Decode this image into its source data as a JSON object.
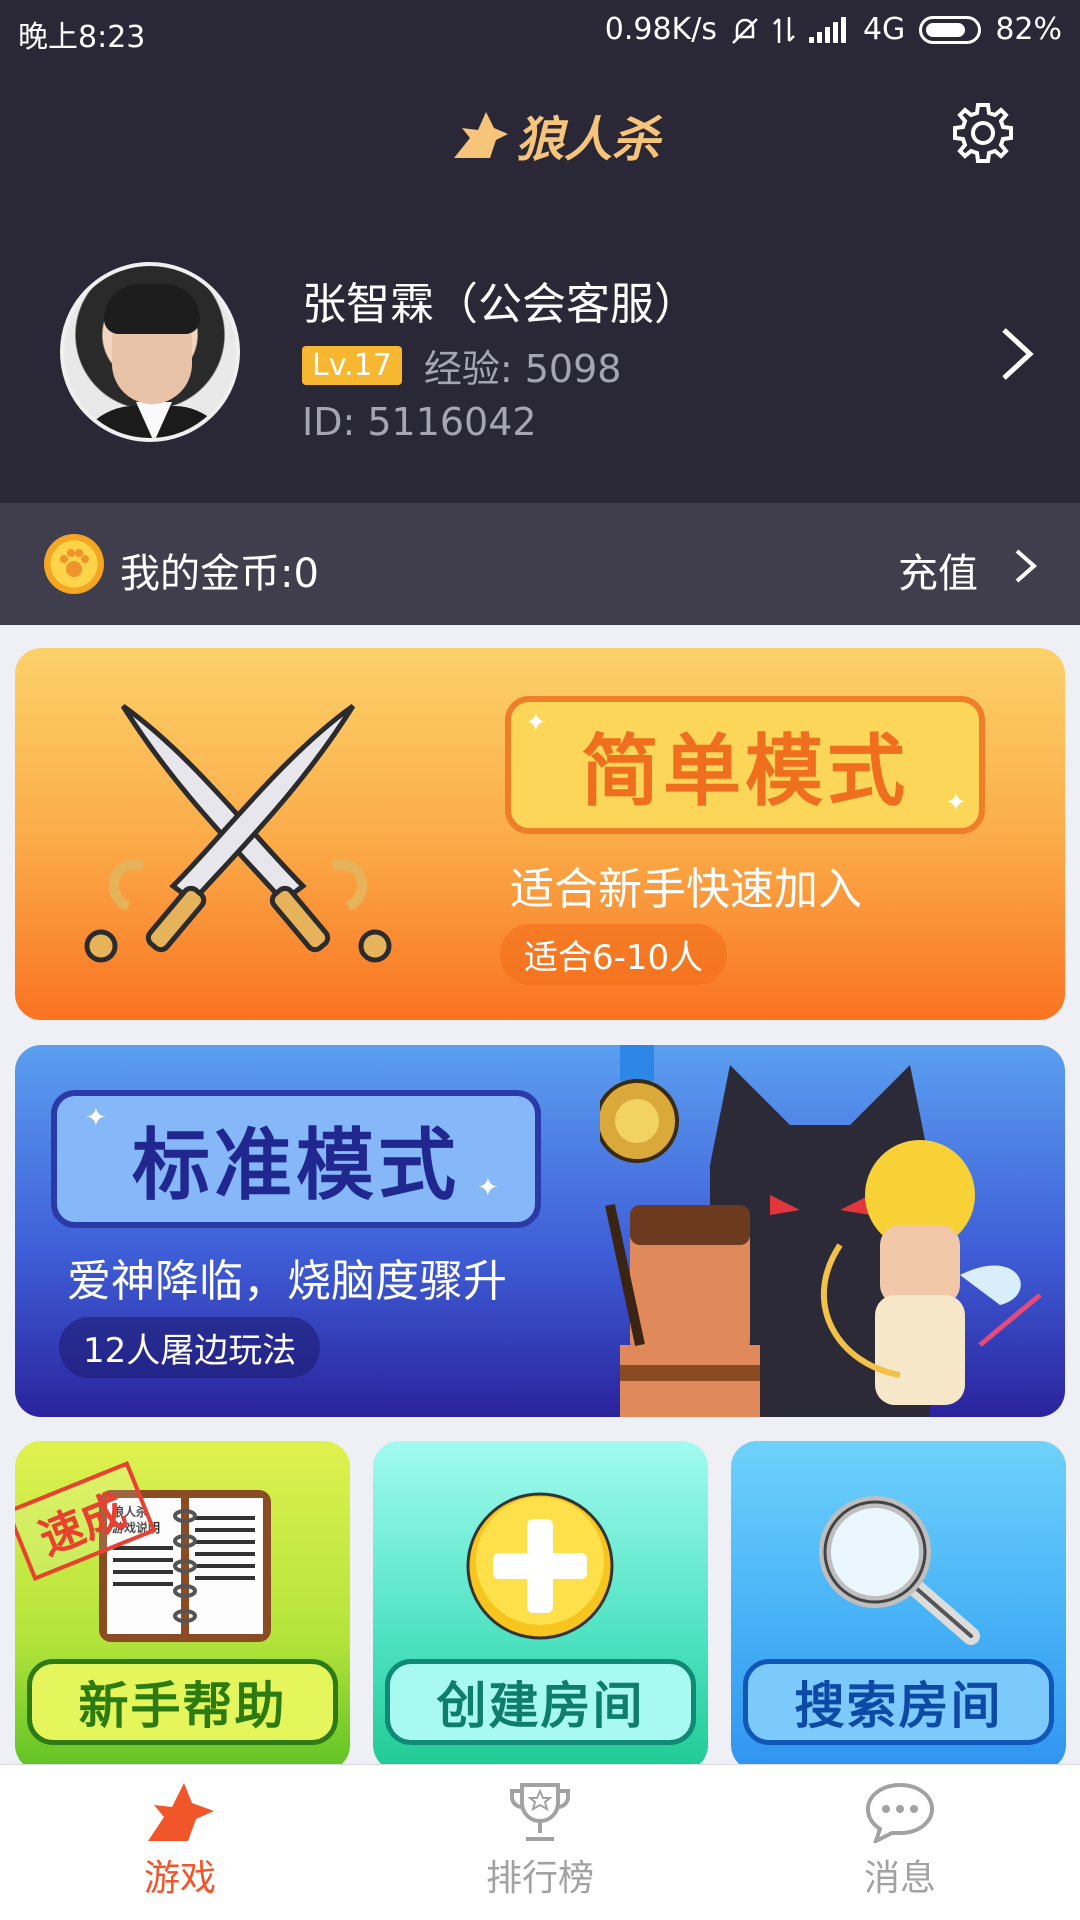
{
  "status_bar": {
    "time": "晚上8:23",
    "network_speed": "0.98K/s",
    "network_type": "4G",
    "battery": "82%",
    "battery_level": 0.82
  },
  "header": {
    "app_title": "狼人杀",
    "settings_icon": "gear-icon"
  },
  "profile": {
    "name": "张智霖（公会客服）",
    "level": "Lv.17",
    "experience": "经验: 5098",
    "id": "ID: 5116042"
  },
  "coins": {
    "label": "我的金币:0",
    "recharge": "充值"
  },
  "modes": {
    "easy": {
      "title": "简单模式",
      "tagline": "适合新手快速加入",
      "players": "适合6-10人"
    },
    "standard": {
      "title": "标准模式",
      "tagline": "爱神降临，烧脑度骤升",
      "players": "12人屠边玩法"
    }
  },
  "actions": {
    "help": "新手帮助",
    "help_stamp": "速成",
    "book_title": "狼人杀 游戏说明",
    "create": "创建房间",
    "search": "搜索房间"
  },
  "bottom_nav": {
    "game": "游戏",
    "ranking": "排行榜",
    "messages": "消息"
  },
  "colors": {
    "header_bg": "#2a2836",
    "coin_bar_bg": "#403e4c",
    "accent_orange": "#f0562a",
    "level_badge": "#f7b731"
  }
}
